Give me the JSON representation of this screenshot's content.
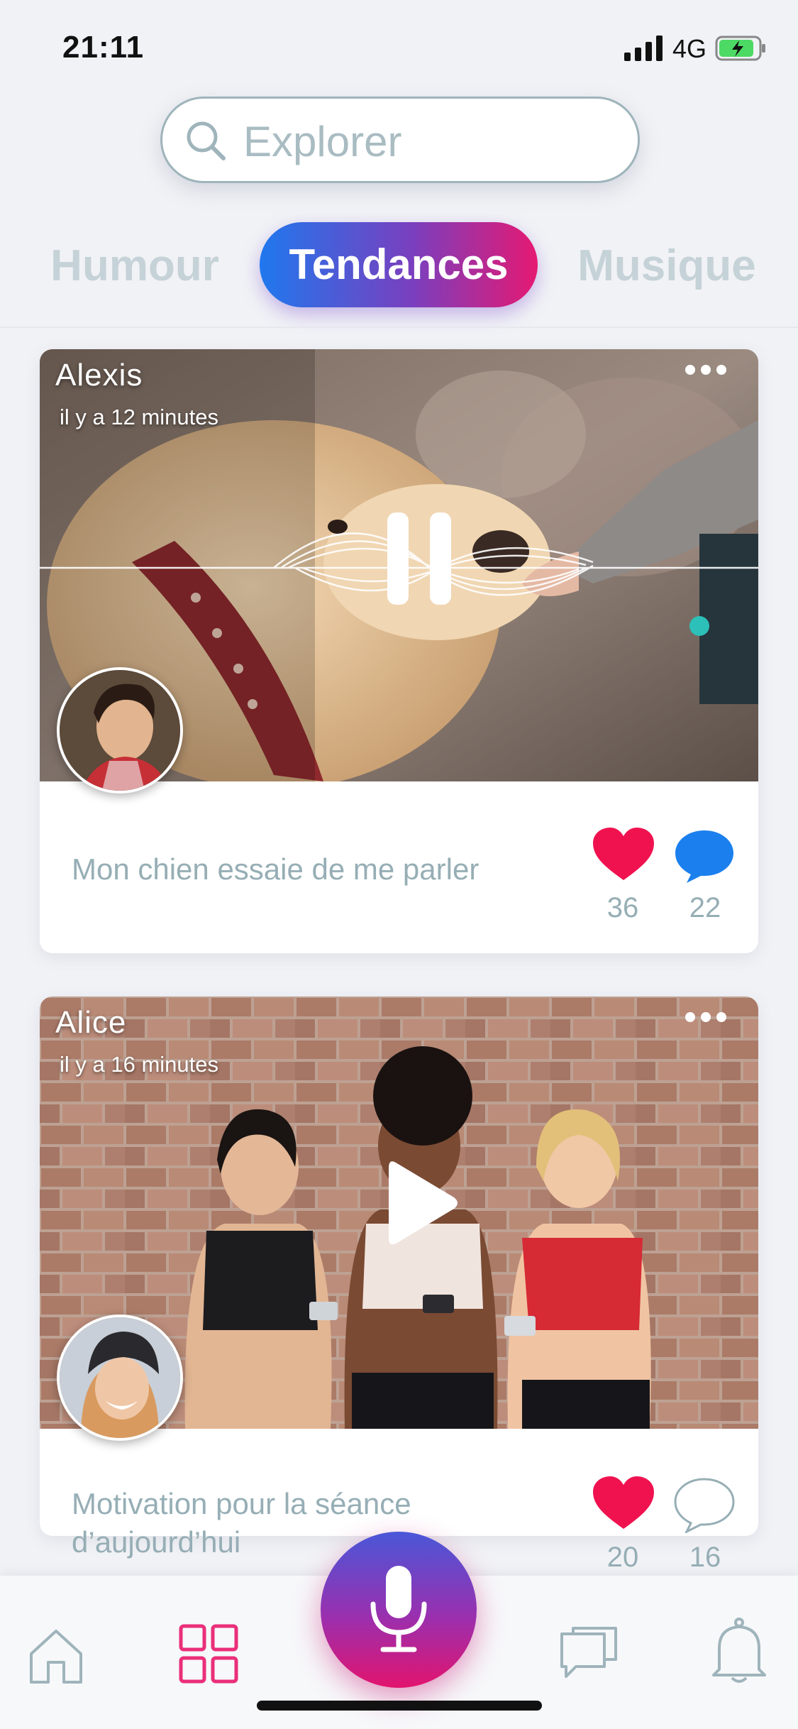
{
  "status_bar": {
    "time": "21:11",
    "network": "4G"
  },
  "search": {
    "placeholder": "Explorer"
  },
  "tabs": [
    {
      "label": "Humour",
      "active": false
    },
    {
      "label": "Tendances",
      "active": true
    },
    {
      "label": "Musique",
      "active": false
    }
  ],
  "posts": [
    {
      "author": "Alexis",
      "time": "il y a 12 minutes",
      "caption": "Mon chien essaie de me parler",
      "likes": "36",
      "comments": "22",
      "state": "playing"
    },
    {
      "author": "Alice",
      "time": "il y a 16 minutes",
      "caption": "Motivation pour la séance d’aujourd’hui",
      "likes": "20",
      "comments": "16",
      "state": "paused"
    }
  ],
  "nav": [
    "home-icon",
    "grid-icon",
    "microphone-icon",
    "chat-icon",
    "bell-icon"
  ],
  "colors": {
    "accent_blue": "#1f78ee",
    "accent_pink": "#e51972",
    "heart": "#f0124f",
    "comment_blue": "#1b80ee",
    "muted_text": "#96aeb5"
  }
}
